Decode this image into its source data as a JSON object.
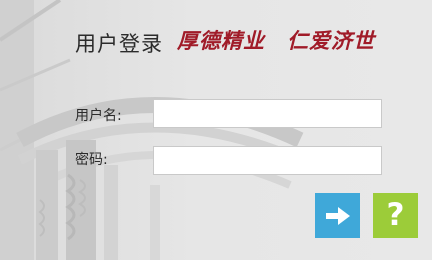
{
  "login": {
    "title": "用户登录",
    "motto_part1": "厚德精业",
    "motto_part2": "仁爱济世",
    "username_label": "用户名:",
    "username_value": "",
    "password_label": "密码:",
    "password_value": "",
    "help_symbol": "?"
  },
  "colors": {
    "motto": "#a01b28",
    "login_button": "#3fa8d9",
    "help_button": "#9ccc39",
    "background": "#e5e5e5"
  },
  "icons": {
    "login_button": "arrow-right-icon",
    "help_button": "question-mark-icon"
  }
}
